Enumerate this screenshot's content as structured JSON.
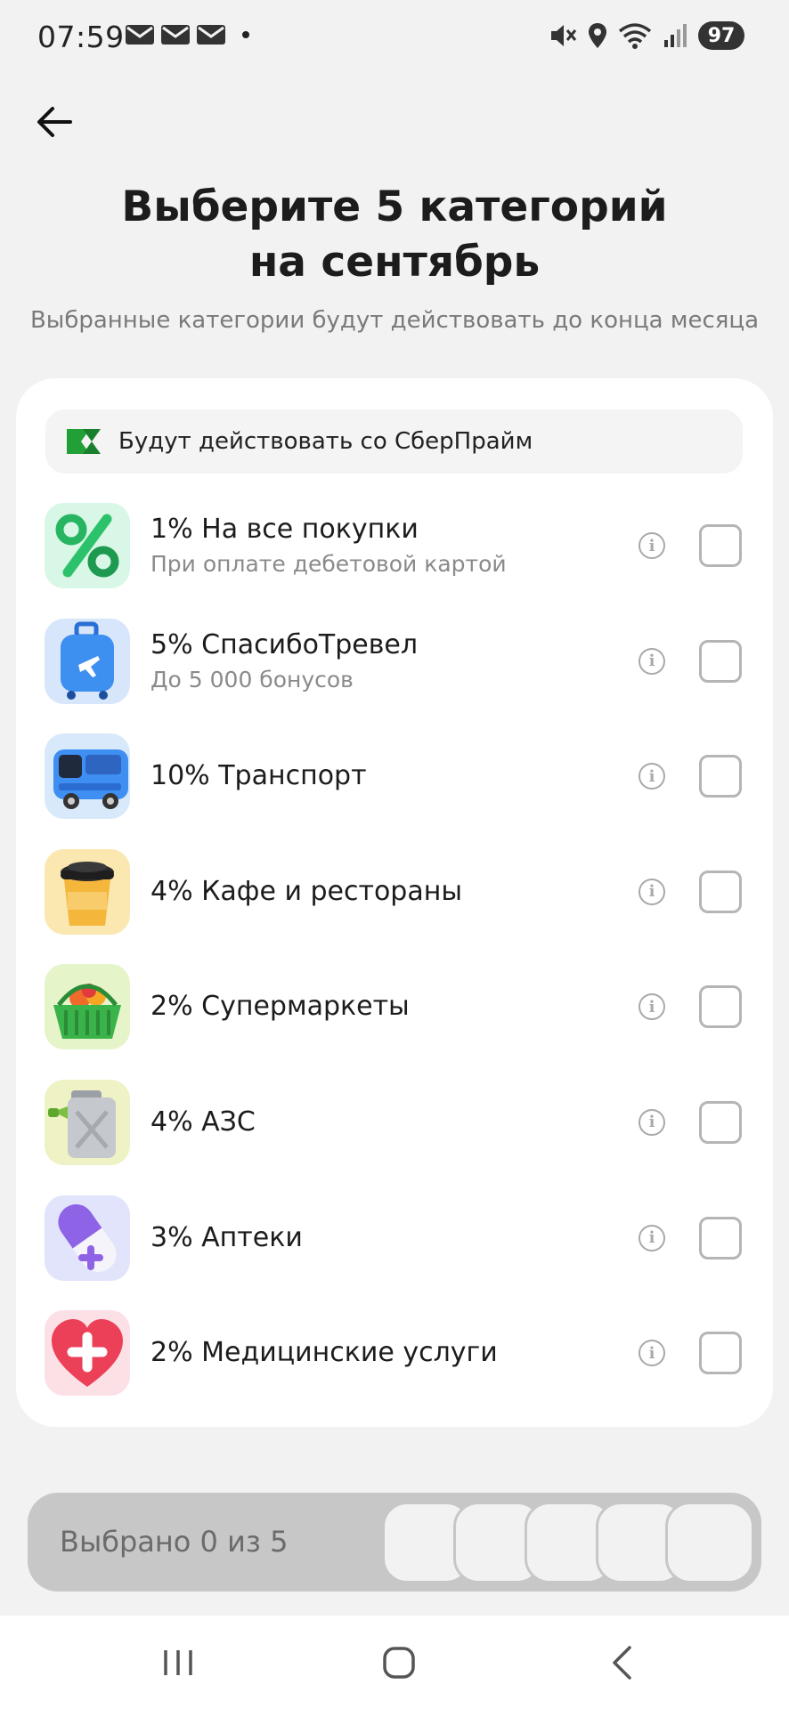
{
  "status_bar": {
    "time": "07:59",
    "left_icons": [
      "mail-icon",
      "mail-icon",
      "mail-icon",
      "dot-icon"
    ],
    "right_icons": [
      "mute-icon",
      "location-icon",
      "wifi-icon",
      "signal-icon"
    ],
    "battery": "97"
  },
  "header": {
    "back_icon": "arrow-left-icon",
    "title_line1": "Выберите 5 категорий",
    "title_line2": "на сентябрь",
    "subtitle": "Выбранные категории будут действовать до конца месяца"
  },
  "banner": {
    "text": "Будут действовать со СберПрайм",
    "accent_color": "#21a038"
  },
  "categories": [
    {
      "title": "1% На все покупки",
      "subtitle": "При оплате дебетовой картой",
      "icon": "percent-icon",
      "checked": false
    },
    {
      "title": "5% СпасибоТревел",
      "subtitle": "До 5 000 бонусов",
      "icon": "suitcase-icon",
      "checked": false
    },
    {
      "title": "10% Транспорт",
      "subtitle": "",
      "icon": "bus-icon",
      "checked": false
    },
    {
      "title": "4% Кафе и рестораны",
      "subtitle": "",
      "icon": "coffee-cup-icon",
      "checked": false
    },
    {
      "title": "2% Супермаркеты",
      "subtitle": "",
      "icon": "shopping-basket-icon",
      "checked": false
    },
    {
      "title": "4% АЗС",
      "subtitle": "",
      "icon": "fuel-canister-icon",
      "checked": false
    },
    {
      "title": "3% Аптеки",
      "subtitle": "",
      "icon": "pill-icon",
      "checked": false
    },
    {
      "title": "2% Медицинские услуги",
      "subtitle": "",
      "icon": "medical-heart-icon",
      "checked": false
    }
  ],
  "selection": {
    "label": "Выбрано 0 из 5",
    "selected": 0,
    "total": 5
  },
  "nav": {
    "recent": "recent-apps-icon",
    "home": "home-icon",
    "back": "back-icon"
  }
}
